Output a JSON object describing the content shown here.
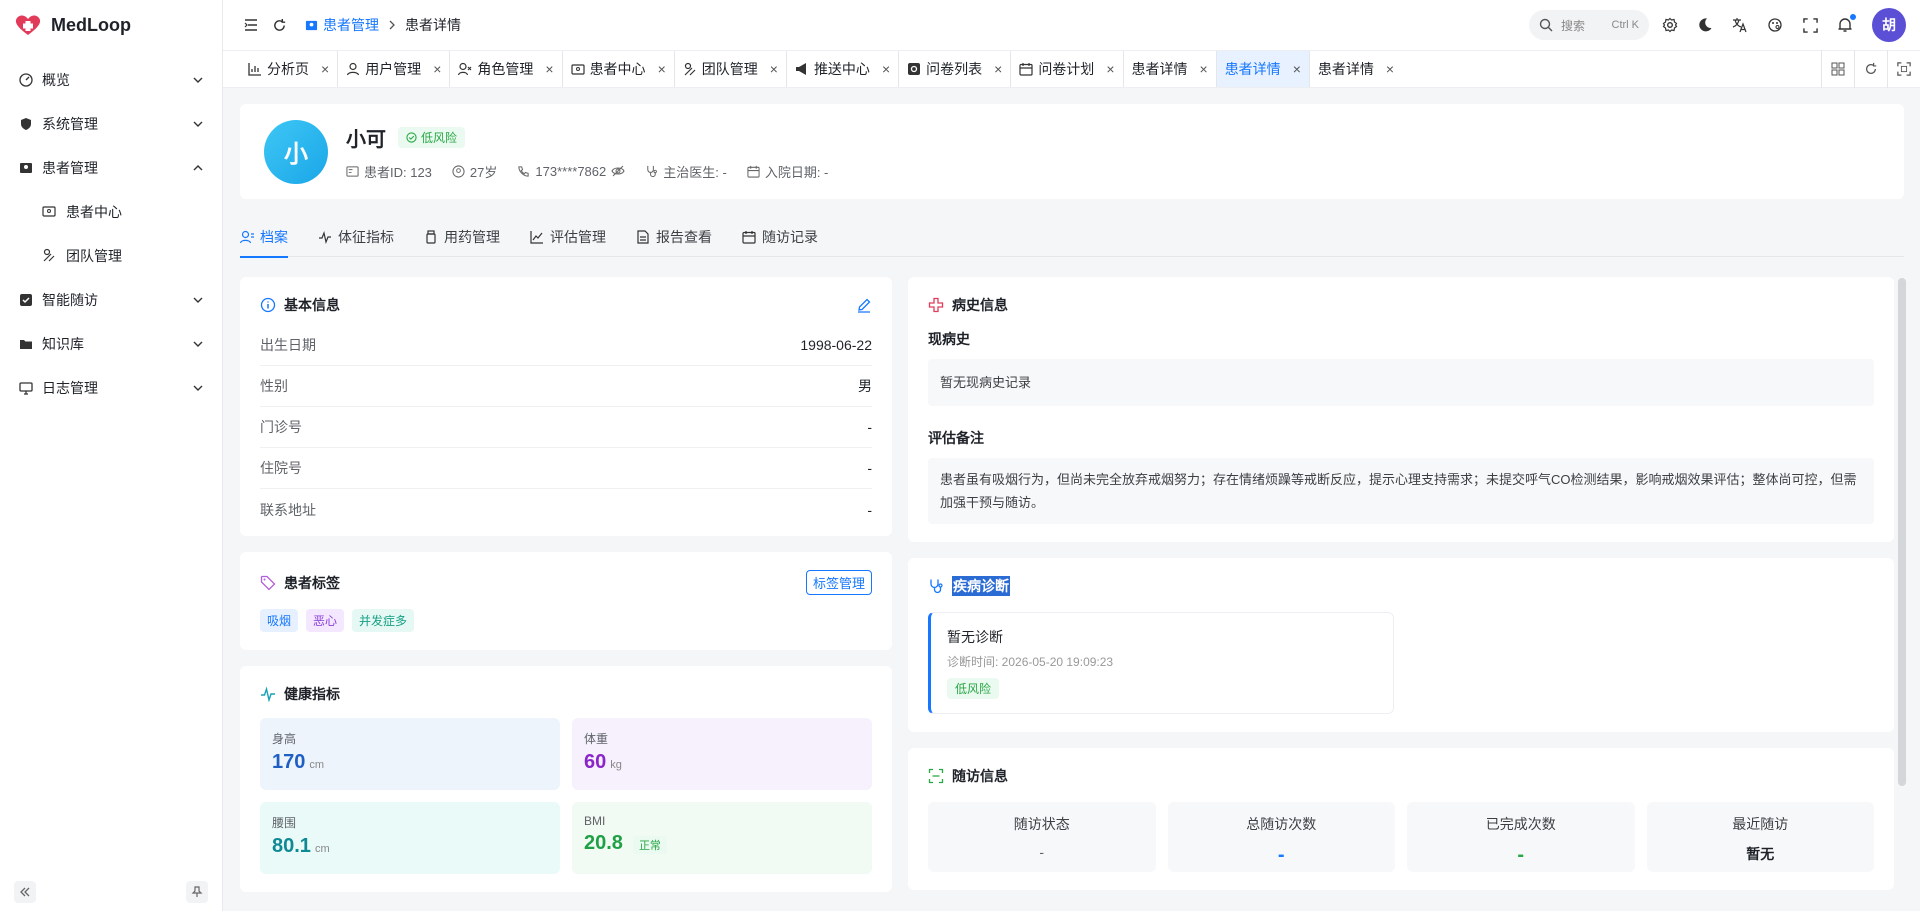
{
  "app": {
    "name": "MedLoop"
  },
  "sidebar": {
    "items": [
      {
        "label": "概览",
        "icon": "dashboard-icon",
        "expanded": false
      },
      {
        "label": "系统管理",
        "icon": "shield-icon",
        "expanded": false
      },
      {
        "label": "患者管理",
        "icon": "patient-icon",
        "expanded": true
      },
      {
        "label": "智能随访",
        "icon": "checkbox-icon",
        "expanded": false
      },
      {
        "label": "知识库",
        "icon": "folder-icon",
        "expanded": false
      },
      {
        "label": "日志管理",
        "icon": "monitor-icon",
        "expanded": false
      }
    ],
    "subitems": [
      {
        "label": "患者中心",
        "icon": "id-card-icon"
      },
      {
        "label": "团队管理",
        "icon": "team-icon"
      }
    ]
  },
  "header": {
    "breadcrumb": [
      "患者管理",
      "患者详情"
    ],
    "search_placeholder": "搜索",
    "search_shortcut": "Ctrl K",
    "avatar_text": "胡"
  },
  "tabs": [
    {
      "label": "分析页",
      "icon": "chart-icon",
      "active": false
    },
    {
      "label": "用户管理",
      "icon": "user-icon",
      "active": false
    },
    {
      "label": "角色管理",
      "icon": "role-icon",
      "active": false
    },
    {
      "label": "患者中心",
      "icon": "id-card-icon",
      "active": false
    },
    {
      "label": "团队管理",
      "icon": "team-icon",
      "active": false
    },
    {
      "label": "推送中心",
      "icon": "megaphone-icon",
      "active": false
    },
    {
      "label": "问卷列表",
      "icon": "list-icon",
      "active": false
    },
    {
      "label": "问卷计划",
      "icon": "calendar-icon",
      "active": false
    },
    {
      "label": "患者详情",
      "icon": "",
      "active": false
    },
    {
      "label": "患者详情",
      "icon": "",
      "active": true
    },
    {
      "label": "患者详情",
      "icon": "",
      "active": false
    }
  ],
  "patient": {
    "avatar_char": "小",
    "name": "小可",
    "risk": "低风险",
    "id": "患者ID: 123",
    "age": "27岁",
    "phone": "173****7862",
    "doctor": "主治医生: -",
    "admission": "入院日期: -"
  },
  "subtabs": [
    {
      "label": "档案",
      "icon": "profile-icon",
      "active": true
    },
    {
      "label": "体征指标",
      "icon": "pulse-icon",
      "active": false
    },
    {
      "label": "用药管理",
      "icon": "medicine-icon",
      "active": false
    },
    {
      "label": "评估管理",
      "icon": "trend-icon",
      "active": false
    },
    {
      "label": "报告查看",
      "icon": "report-icon",
      "active": false
    },
    {
      "label": "随访记录",
      "icon": "calendar-icon",
      "active": false
    }
  ],
  "basic_info": {
    "title": "基本信息",
    "rows": [
      {
        "k": "出生日期",
        "v": "1998-06-22"
      },
      {
        "k": "性别",
        "v": "男"
      },
      {
        "k": "门诊号",
        "v": "-"
      },
      {
        "k": "住院号",
        "v": "-"
      },
      {
        "k": "联系地址",
        "v": "-"
      }
    ]
  },
  "tags_card": {
    "title": "患者标签",
    "button": "标签管理",
    "tags": [
      {
        "label": "吸烟",
        "bg": "#e6f0ff",
        "fg": "#1677ff"
      },
      {
        "label": "恶心",
        "bg": "#f3e8ff",
        "fg": "#8b3fd9"
      },
      {
        "label": "并发症多",
        "bg": "#e6f8f3",
        "fg": "#16a085"
      }
    ]
  },
  "health": {
    "title": "健康指标",
    "metrics": [
      {
        "k": "身高",
        "v": "170",
        "u": "cm",
        "bg": "#eef4fc",
        "fg": "#1f5fc4",
        "badge": ""
      },
      {
        "k": "体重",
        "v": "60",
        "u": "kg",
        "bg": "#f6f1fc",
        "fg": "#8b25c9",
        "badge": ""
      },
      {
        "k": "腰围",
        "v": "80.1",
        "u": "cm",
        "bg": "#eafaf9",
        "fg": "#0f8a95",
        "badge": ""
      },
      {
        "k": "BMI",
        "v": "20.8",
        "u": "",
        "bg": "#f1faf3",
        "fg": "#20a045",
        "badge": "正常"
      }
    ]
  },
  "history": {
    "title": "病史信息",
    "current_label": "现病史",
    "current_text": "暂无现病史记录",
    "note_label": "评估备注",
    "note_text": "患者虽有吸烟行为，但尚未完全放弃戒烟努力；存在情绪烦躁等戒断反应，提示心理支持需求；未提交呼气CO检测结果，影响戒烟效果评估；整体尚可控，但需加强干预与随访。"
  },
  "diagnosis": {
    "title": "疾病诊断",
    "item_title": "暂无诊断",
    "item_time": "诊断时间: 2026-05-20 19:09:23",
    "item_risk": "低风险"
  },
  "followup": {
    "title": "随访信息",
    "cells": [
      {
        "k": "随访状态",
        "v": "-",
        "color": "#5f6368"
      },
      {
        "k": "总随访次数",
        "v": "-",
        "color": "#1677ff"
      },
      {
        "k": "已完成次数",
        "v": "-",
        "color": "#28a745"
      },
      {
        "k": "最近随访",
        "v": "暂无",
        "color": "#1f2329"
      }
    ]
  }
}
